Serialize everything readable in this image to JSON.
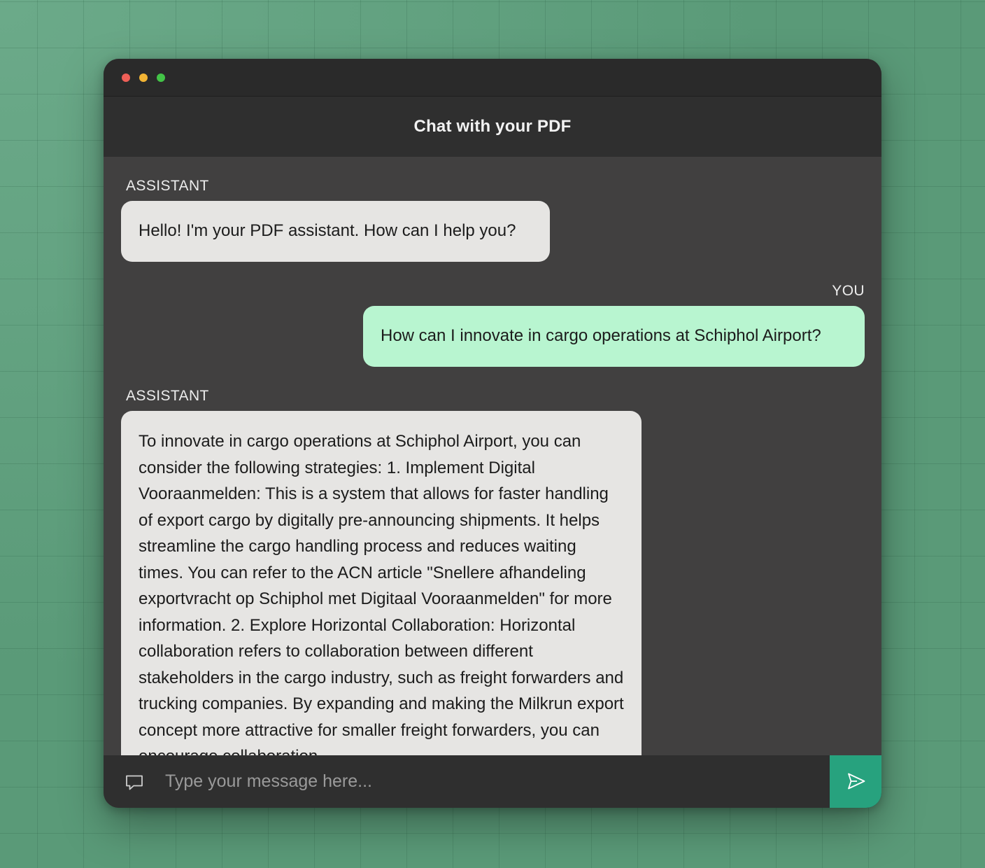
{
  "window": {
    "controls": [
      "close",
      "minimize",
      "zoom"
    ]
  },
  "header": {
    "title": "Chat with your PDF"
  },
  "messages": [
    {
      "role_label": "ASSISTANT",
      "text": "Hello! I'm your PDF assistant. How can I help you?"
    },
    {
      "role_label": "YOU",
      "text": "How can I innovate in cargo operations at Schiphol Airport?"
    },
    {
      "role_label": "ASSISTANT",
      "text": "To innovate in cargo operations at Schiphol Airport, you can consider the following strategies: 1. Implement Digital Vooraanmelden: This is a system that allows for faster handling of export cargo by digitally pre-announcing shipments. It helps streamline the cargo handling process and reduces waiting times. You can refer to the ACN article \"Snellere afhandeling exportvracht op Schiphol met Digitaal Vooraanmelden\" for more information. 2. Explore Horizontal Collaboration: Horizontal collaboration refers to collaboration between different stakeholders in the cargo industry, such as freight forwarders and trucking companies. By expanding and making the Milkrun export concept more attractive for smaller freight forwarders, you can encourage collaboration"
    }
  ],
  "input": {
    "placeholder": "Type your message here...",
    "value": ""
  },
  "icons": {
    "input_icon": "chat-bubble-icon",
    "send_icon": "send-icon"
  },
  "colors": {
    "send_button": "#27a27e",
    "user_bubble": "#b8f5d0",
    "assistant_bubble": "#e6e5e3"
  }
}
